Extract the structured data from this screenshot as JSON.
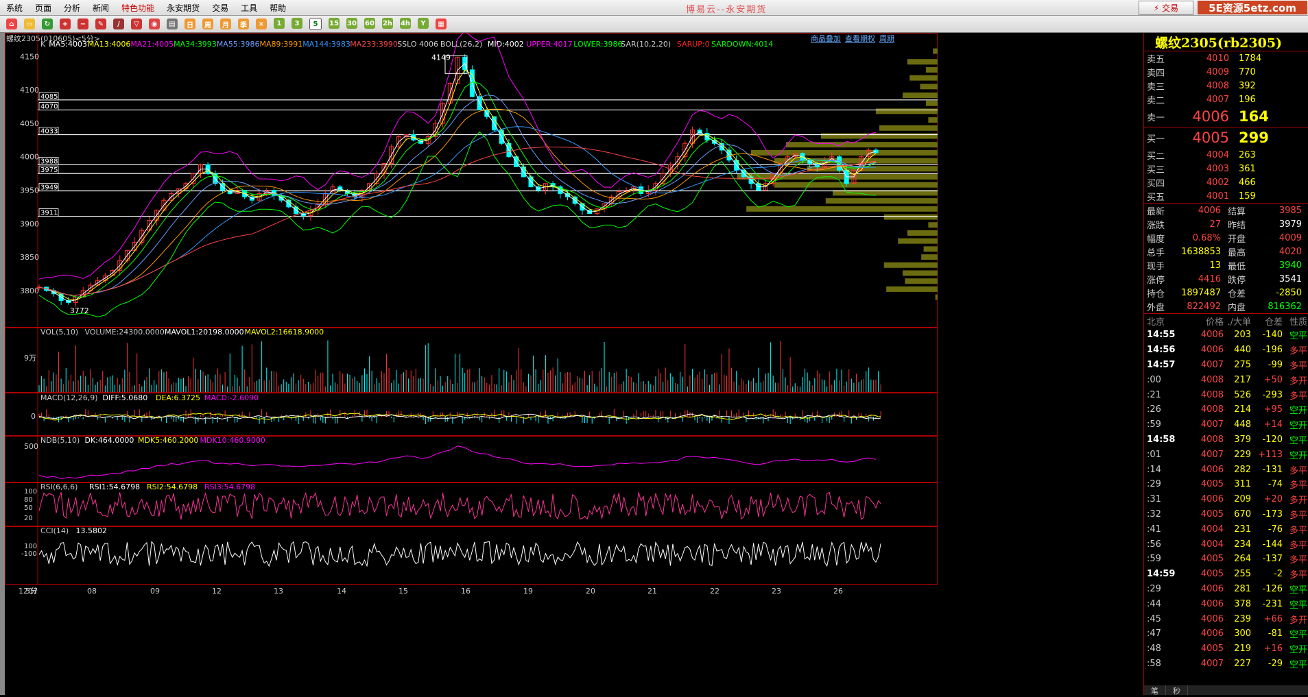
{
  "menu": [
    "系统",
    "页面",
    "分析",
    "新闻",
    "特色功能",
    "永安期货",
    "交易",
    "工具",
    "帮助"
  ],
  "app_title": "博易云--永安期货",
  "trade_button": "⚡ 交易",
  "watermark": "5E资源5etz.com",
  "toolbar": {
    "periods": [
      "1",
      "3",
      "5",
      "15",
      "30",
      "60",
      "2h",
      "4h",
      "Y"
    ],
    "active_period": "5"
  },
  "chart": {
    "symbol_label": "螺纹2305(010605)<5分>",
    "top_links": [
      "商品叠加",
      "查看期权",
      "周期"
    ],
    "ma_line": [
      {
        "t": "K",
        "c": "#cccccc"
      },
      {
        "t": "MA5:4003",
        "c": "#ffffff"
      },
      {
        "t": "MA13:4006",
        "c": "#ffff00"
      },
      {
        "t": "MA21:4005",
        "c": "#ff00ff"
      },
      {
        "t": "MA34:3993",
        "c": "#00ff00"
      },
      {
        "t": "MA55:3986",
        "c": "#6a9bff"
      },
      {
        "t": "MA89:3991",
        "c": "#ff9900"
      },
      {
        "t": "MA144:3983",
        "c": "#3399ff"
      },
      {
        "t": "MA233:3990",
        "c": "#ff4444"
      },
      {
        "t": "SSLO 4006",
        "c": "#cccccc"
      },
      {
        "t": "BOLL(26,2)",
        "c": "#cccccc"
      },
      {
        "t": "MID:4002",
        "c": "#ffffff"
      },
      {
        "t": "UPPER:4017",
        "c": "#ff00ff"
      },
      {
        "t": "LOWER:3986",
        "c": "#00ff00"
      },
      {
        "t": "SAR(10,2,20)",
        "c": "#cccccc"
      },
      {
        "t": "SARUP:0",
        "c": "#ff2222"
      },
      {
        "t": "SARDOWN:4014",
        "c": "#00ff00"
      }
    ],
    "price_axis": [
      4150,
      4100,
      4050,
      4000,
      3950,
      3900,
      3850,
      3800
    ],
    "price_range": [
      3765,
      4175
    ],
    "level_labels": [
      4085,
      4070,
      4033,
      3988,
      3975,
      3949,
      3911
    ],
    "high_label": "4149",
    "low_label": "3772",
    "candles": [
      3805,
      3800,
      3795,
      3785,
      3782,
      3790,
      3800,
      3808,
      3815,
      3822,
      3830,
      3845,
      3860,
      3872,
      3890,
      3905,
      3920,
      3935,
      3945,
      3952,
      3960,
      3975,
      3988,
      3975,
      3960,
      3950,
      3945,
      3950,
      3940,
      3935,
      3945,
      3950,
      3942,
      3935,
      3925,
      3915,
      3912,
      3920,
      3930,
      3945,
      3955,
      3950,
      3945,
      3940,
      3950,
      3960,
      3975,
      3990,
      4015,
      4030,
      4033,
      4025,
      4020,
      4030,
      4050,
      4080,
      4110,
      4149,
      4130,
      4090,
      4070,
      4060,
      4040,
      4020,
      4000,
      3985,
      3970,
      3955,
      3950,
      3960,
      3955,
      3945,
      3940,
      3930,
      3920,
      3915,
      3922,
      3930,
      3940,
      3948,
      3950,
      3955,
      3945,
      3950,
      3960,
      3975,
      3988,
      4000,
      4020,
      4040,
      4035,
      4025,
      4020,
      4010,
      3995,
      3980,
      3970,
      3960,
      3950,
      3960,
      3975,
      3990,
      4000,
      4005,
      3995,
      3990,
      3985,
      3995,
      4000,
      3980,
      3960,
      3980,
      4000,
      4010,
      4006
    ],
    "volume_profile": [
      {
        "price": 4158,
        "w": 20
      },
      {
        "price": 4142,
        "w": 130
      },
      {
        "price": 4130,
        "w": 50
      },
      {
        "price": 4118,
        "w": 120
      },
      {
        "price": 4105,
        "w": 75
      },
      {
        "price": 4092,
        "w": 150
      },
      {
        "price": 4080,
        "w": 50
      },
      {
        "price": 4068,
        "w": 265
      },
      {
        "price": 4055,
        "w": 40
      },
      {
        "price": 4043,
        "w": 250
      },
      {
        "price": 4031,
        "w": 500
      },
      {
        "price": 4018,
        "w": 650
      },
      {
        "price": 4006,
        "w": 800
      },
      {
        "price": 3994,
        "w": 700
      },
      {
        "price": 3982,
        "w": 560
      },
      {
        "price": 3970,
        "w": 860
      },
      {
        "price": 3958,
        "w": 700
      },
      {
        "price": 3946,
        "w": 450
      },
      {
        "price": 3934,
        "w": 480
      },
      {
        "price": 3922,
        "w": 820
      },
      {
        "price": 3910,
        "w": 230
      },
      {
        "price": 3898,
        "w": 40
      },
      {
        "price": 3886,
        "w": 130
      },
      {
        "price": 3874,
        "w": 170
      },
      {
        "price": 3862,
        "w": 60
      },
      {
        "price": 3850,
        "w": 70
      },
      {
        "price": 3838,
        "w": 230
      },
      {
        "price": 3826,
        "w": 150
      },
      {
        "price": 3814,
        "w": 140
      },
      {
        "price": 3802,
        "w": 220
      },
      {
        "price": 3790,
        "w": 10
      }
    ],
    "volume_header": [
      {
        "t": "VOL(5,10)",
        "c": "#cccccc"
      },
      {
        "t": "VOLUME:24300.0000",
        "c": "#cccccc"
      },
      {
        "t": "MAVOL1:20198.0000",
        "c": "#ffffff"
      },
      {
        "t": "MAVOL2:16618.9000",
        "c": "#ffff00"
      }
    ],
    "volume_axis": "9万",
    "macd_header": [
      {
        "t": "MACD(12,26,9)",
        "c": "#cccccc"
      },
      {
        "t": "DIFF:5.0680",
        "c": "#ffffff"
      },
      {
        "t": "DEA:6.3725",
        "c": "#ffff00"
      },
      {
        "t": "MACD:-2.6090",
        "c": "#ff00ff"
      }
    ],
    "macd_axis": "0",
    "ndb_header": [
      {
        "t": "NDB(5,10)",
        "c": "#cccccc"
      },
      {
        "t": "DK:464.0000",
        "c": "#ffffff"
      },
      {
        "t": "MDK5:460.2000",
        "c": "#ffff00"
      },
      {
        "t": "MDK10:460.9000",
        "c": "#ff00ff"
      }
    ],
    "ndb_axis": "500",
    "rsi_header": [
      {
        "t": "RSI(6,6,6)",
        "c": "#cccccc"
      },
      {
        "t": "RSI1:54.6798",
        "c": "#ffffff"
      },
      {
        "t": "RSI2:54.6798",
        "c": "#ffff00"
      },
      {
        "t": "RSI3:54.6798",
        "c": "#ff00ff"
      }
    ],
    "rsi_axis": [
      "100",
      "80",
      "50",
      "20"
    ],
    "cci_header": [
      {
        "t": "CCI(14)",
        "c": "#cccccc"
      },
      {
        "t": "13.5802",
        "c": "#ffffff"
      }
    ],
    "cci_axis": [
      "100",
      "-100"
    ],
    "time_axis": [
      "5分",
      "1207",
      "08",
      "09",
      "12",
      "13",
      "14",
      "15",
      "16",
      "19",
      "20",
      "21",
      "22",
      "23",
      "26"
    ]
  },
  "quote": {
    "title": "螺纹2305(rb2305)",
    "asks": [
      {
        "label": "卖五",
        "price": "4010",
        "vol": "1784"
      },
      {
        "label": "卖四",
        "price": "4009",
        "vol": "770"
      },
      {
        "label": "卖三",
        "price": "4008",
        "vol": "392"
      },
      {
        "label": "卖二",
        "price": "4007",
        "vol": "196"
      }
    ],
    "ask1": {
      "label": "卖一",
      "price": "4006",
      "vol": "164"
    },
    "bid1": {
      "label": "买一",
      "price": "4005",
      "vol": "299"
    },
    "bids": [
      {
        "label": "买二",
        "price": "4004",
        "vol": "263"
      },
      {
        "label": "买三",
        "price": "4003",
        "vol": "361"
      },
      {
        "label": "买四",
        "price": "4002",
        "vol": "466"
      },
      {
        "label": "买五",
        "price": "4001",
        "vol": "159"
      }
    ],
    "stats": [
      {
        "l1": "最新",
        "v1": "4006",
        "c1": "#ff4444",
        "l2": "结算",
        "v2": "3985",
        "c2": "#ff4444"
      },
      {
        "l1": "涨跌",
        "v1": "27",
        "c1": "#ff4444",
        "l2": "昨结",
        "v2": "3979",
        "c2": "#ffffff"
      },
      {
        "l1": "幅度",
        "v1": "0.68%",
        "c1": "#ff4444",
        "l2": "开盘",
        "v2": "4009",
        "c2": "#ff4444"
      },
      {
        "l1": "总手",
        "v1": "1638853",
        "c1": "#ffff00",
        "l2": "最高",
        "v2": "4020",
        "c2": "#ff4444"
      },
      {
        "l1": "现手",
        "v1": "13",
        "c1": "#ffff00",
        "l2": "最低",
        "v2": "3940",
        "c2": "#00ff00"
      },
      {
        "l1": "涨停",
        "v1": "4416",
        "c1": "#ff4444",
        "l2": "跌停",
        "v2": "3541",
        "c2": "#ffffff"
      },
      {
        "l1": "持仓",
        "v1": "1897487",
        "c1": "#ffff00",
        "l2": "仓差",
        "v2": "-2850",
        "c2": "#ffff00"
      },
      {
        "l1": "外盘",
        "v1": "822492",
        "c1": "#ff4444",
        "l2": "内盘",
        "v2": "816362",
        "c2": "#00ff00"
      }
    ],
    "tick_header": [
      "北京",
      "价格",
      "./大单",
      "仓差",
      "性质"
    ],
    "ticks": [
      {
        "t": "14:55",
        "full": true,
        "p": "4006",
        "v": "203",
        "d": "-140",
        "k": "空平"
      },
      {
        "t": "14:56",
        "full": true,
        "p": "4006",
        "v": "440",
        "d": "-196",
        "k": "多平"
      },
      {
        "t": "14:57",
        "full": true,
        "p": "4007",
        "v": "275",
        "d": "-99",
        "k": "多平"
      },
      {
        "t": ":00",
        "full": false,
        "p": "4008",
        "v": "217",
        "d": "+50",
        "k": "多开"
      },
      {
        "t": ":21",
        "full": false,
        "p": "4008",
        "v": "526",
        "d": "-293",
        "k": "多平"
      },
      {
        "t": ":26",
        "full": false,
        "p": "4008",
        "v": "214",
        "d": "+95",
        "k": "空开"
      },
      {
        "t": ":59",
        "full": false,
        "p": "4007",
        "v": "448",
        "d": "+14",
        "k": "空开"
      },
      {
        "t": "14:58",
        "full": true,
        "p": "4008",
        "v": "379",
        "d": "-120",
        "k": "空平"
      },
      {
        "t": ":01",
        "full": false,
        "p": "4007",
        "v": "229",
        "d": "+113",
        "k": "空开"
      },
      {
        "t": ":14",
        "full": false,
        "p": "4006",
        "v": "282",
        "d": "-131",
        "k": "多平"
      },
      {
        "t": ":29",
        "full": false,
        "p": "4005",
        "v": "311",
        "d": "-74",
        "k": "多平"
      },
      {
        "t": ":31",
        "full": false,
        "p": "4006",
        "v": "209",
        "d": "+20",
        "k": "多开"
      },
      {
        "t": ":32",
        "full": false,
        "p": "4005",
        "v": "670",
        "d": "-173",
        "k": "多平"
      },
      {
        "t": ":41",
        "full": false,
        "p": "4004",
        "v": "231",
        "d": "-76",
        "k": "多平"
      },
      {
        "t": ":56",
        "full": false,
        "p": "4004",
        "v": "234",
        "d": "-144",
        "k": "多平"
      },
      {
        "t": ":59",
        "full": false,
        "p": "4005",
        "v": "264",
        "d": "-137",
        "k": "多平"
      },
      {
        "t": "14:59",
        "full": true,
        "p": "4005",
        "v": "255",
        "d": "-2",
        "k": "多平"
      },
      {
        "t": ":29",
        "full": false,
        "p": "4006",
        "v": "281",
        "d": "-126",
        "k": "空平"
      },
      {
        "t": ":44",
        "full": false,
        "p": "4006",
        "v": "378",
        "d": "-231",
        "k": "空平"
      },
      {
        "t": ":45",
        "full": false,
        "p": "4006",
        "v": "239",
        "d": "+66",
        "k": "多开"
      },
      {
        "t": ":47",
        "full": false,
        "p": "4006",
        "v": "300",
        "d": "-81",
        "k": "空平"
      },
      {
        "t": ":48",
        "full": false,
        "p": "4005",
        "v": "219",
        "d": "+16",
        "k": "空开"
      },
      {
        "t": ":58",
        "full": false,
        "p": "4007",
        "v": "227",
        "d": "-29",
        "k": "空平"
      }
    ],
    "bottom_tabs": [
      "笔",
      "秒"
    ]
  }
}
